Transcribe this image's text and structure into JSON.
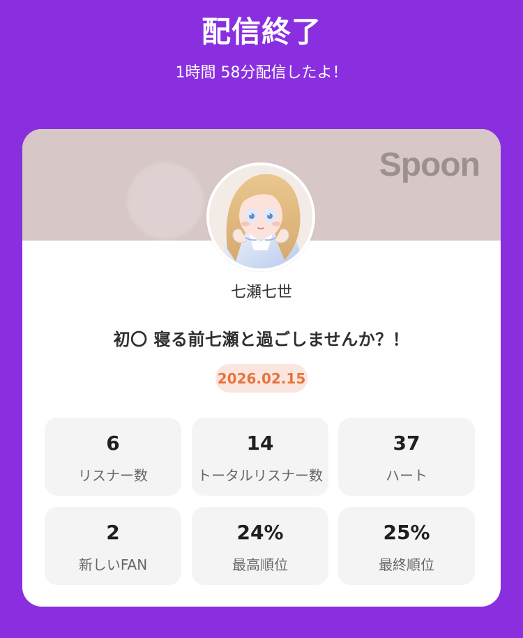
{
  "header": {
    "title": "配信終了",
    "subtitle": "1時間 58分配信したよ！"
  },
  "card": {
    "brand": "Spoon",
    "user_name": "七瀬七世",
    "title": "初〇 寝る前七瀬と過ごしませんか？！",
    "date": "2026.02.15"
  },
  "stats": [
    {
      "value": "6",
      "label": "リスナー数"
    },
    {
      "value": "14",
      "label": "トータルリスナー数"
    },
    {
      "value": "37",
      "label": "ハート"
    },
    {
      "value": "2",
      "label": "新しいFAN"
    },
    {
      "value": "24%",
      "label": "最高順位"
    },
    {
      "value": "25%",
      "label": "最終順位"
    }
  ],
  "colors": {
    "background": "#8a2fe0",
    "card": "#ffffff",
    "banner": "#d8c7c7",
    "date_badge_bg": "#fbe6df",
    "date_badge_text": "#e5753d",
    "stat_bg": "#f4f4f4"
  }
}
